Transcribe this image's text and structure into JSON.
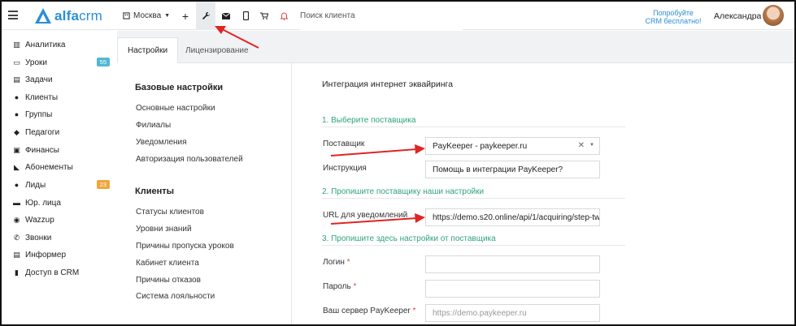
{
  "topbar": {
    "logo_text": "alfacrm",
    "city": "Москва",
    "search_placeholder": "Поиск клиента",
    "promo_line1": "Попробуйте",
    "promo_line2": "CRM бесплатно!",
    "user_name": "Александра"
  },
  "sidebar": {
    "items": [
      {
        "label": "Аналитика",
        "icon": "book-icon"
      },
      {
        "label": "Уроки",
        "icon": "calendar-icon",
        "badge": "55",
        "badge_color": "#4fb8d4"
      },
      {
        "label": "Задачи",
        "icon": "tasks-icon"
      },
      {
        "label": "Клиенты",
        "icon": "user-icon"
      },
      {
        "label": "Группы",
        "icon": "group-icon"
      },
      {
        "label": "Педагоги",
        "icon": "graduation-cap-icon"
      },
      {
        "label": "Финансы",
        "icon": "money-icon"
      },
      {
        "label": "Абонементы",
        "icon": "tag-icon"
      },
      {
        "label": "Лиды",
        "icon": "user-plus-icon",
        "badge": "23",
        "badge_color": "#f0a63a"
      },
      {
        "label": "Юр. лица",
        "icon": "briefcase-icon"
      },
      {
        "label": "Wazzup",
        "icon": "whatsapp-icon"
      },
      {
        "label": "Звонки",
        "icon": "phone-icon"
      },
      {
        "label": "Информер",
        "icon": "document-icon"
      },
      {
        "label": "Доступ в CRM",
        "icon": "lock-icon"
      }
    ]
  },
  "tabs": [
    {
      "label": "Настройки",
      "active": true
    },
    {
      "label": "Лицензирование",
      "active": false
    }
  ],
  "settings_menu": {
    "base_heading": "Базовые настройки",
    "base_links": [
      "Основные настройки",
      "Филиалы",
      "Уведомления",
      "Авторизация пользователей"
    ],
    "clients_heading": "Клиенты",
    "clients_links": [
      "Статусы клиентов",
      "Уровни знаний",
      "Причины пропуска уроков",
      "Кабинет клиента",
      "Причины отказов",
      "Система лояльности"
    ]
  },
  "content": {
    "title": "Интеграция интернет эквайринга",
    "section1": "1. Выберите поставщика",
    "provider_label": "Поставщик",
    "provider_value": "PayKeeper - paykeeper.ru",
    "instruction_label": "Инструкция",
    "instruction_value": "Помощь в интеграции PayKeeper?",
    "section2": "2. Пропишите поставщику наши настройки",
    "url_label": "URL для уведомлений",
    "url_value": "https://demo.s20.online/api/1/acquiring/step-tw",
    "section3": "3. Пропишите здесь настройки от поставщика",
    "login_label": "Логин",
    "password_label": "Пароль",
    "server_label": "Ваш сервер PayKeeper",
    "server_placeholder": "https://demo.paykeeper.ru",
    "required_mark": "*"
  },
  "colors": {
    "accent": "#2a8ed8",
    "section_green": "#2fa37c",
    "annotation_red": "#e02424"
  }
}
